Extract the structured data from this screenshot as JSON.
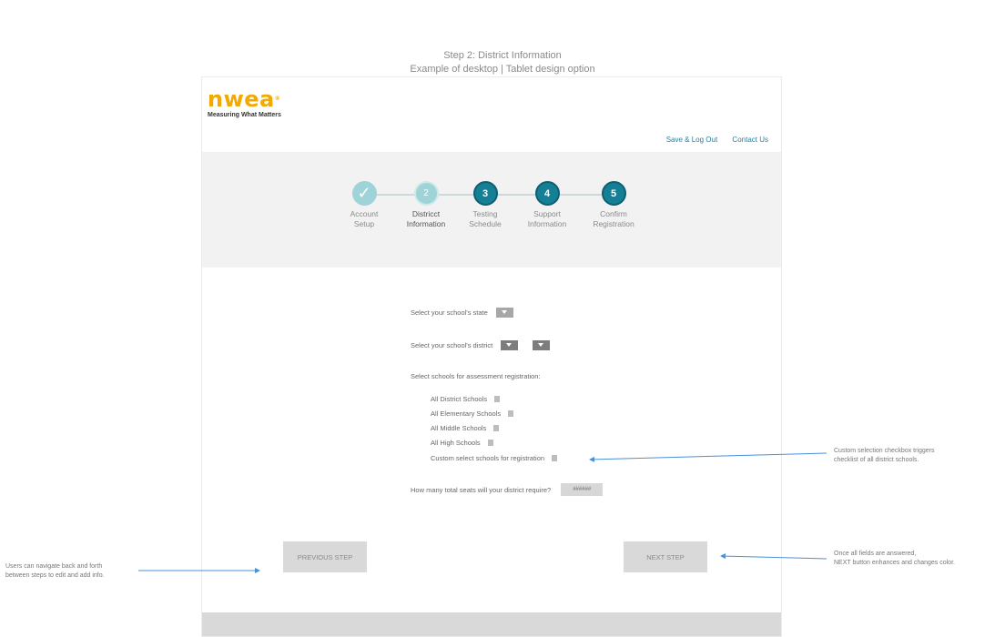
{
  "caption": {
    "line1": "Step 2: District Information",
    "line2": "Example of desktop | Tablet design option"
  },
  "header": {
    "logo_text": "nwea",
    "logo_reg": "®",
    "tagline": "Measuring What Matters",
    "links": {
      "save_logout": "Save & Log Out",
      "contact": "Contact Us"
    }
  },
  "stepper": {
    "steps": [
      {
        "number": "✓",
        "line1": "Account",
        "line2": "Setup",
        "state": "complete"
      },
      {
        "number": "2",
        "line1": "Districct",
        "line2": "Information",
        "state": "current"
      },
      {
        "number": "3",
        "line1": "Testing",
        "line2": "Schedule",
        "state": "upcoming"
      },
      {
        "number": "4",
        "line1": "Support",
        "line2": "Information",
        "state": "upcoming"
      },
      {
        "number": "5",
        "line1": "Confirm",
        "line2": "Registration",
        "state": "upcoming"
      }
    ]
  },
  "form": {
    "state_label": "Select your school's state",
    "district_label": "Select your school's district",
    "schools_label": "Select schools for assessment registration:",
    "options": [
      "All District Schools",
      "All Elementary Schools",
      "All Middle Schools",
      "All High Schools",
      "Custom select schools for registration"
    ],
    "seats_label": "How many total seats will your district require?",
    "seats_value": "######"
  },
  "nav": {
    "previous": "PREVIOUS STEP",
    "next": "NEXT STEP"
  },
  "annotations": {
    "custom_line1": "Custom selection checkbox triggers",
    "custom_line2": "checklist of all district schools.",
    "next_line1": "Once all fields are answered,",
    "next_line2": "NEXT button enhances and changes color.",
    "back_line1": "Users can navigate back and forth",
    "back_line2": "between steps to edit and add info."
  },
  "colors": {
    "brand_orange": "#f2a900",
    "step_complete": "#9ed3d8",
    "step_upcoming": "#157f96",
    "link": "#2a7f9e",
    "annotation_arrow": "#4a90d9"
  }
}
